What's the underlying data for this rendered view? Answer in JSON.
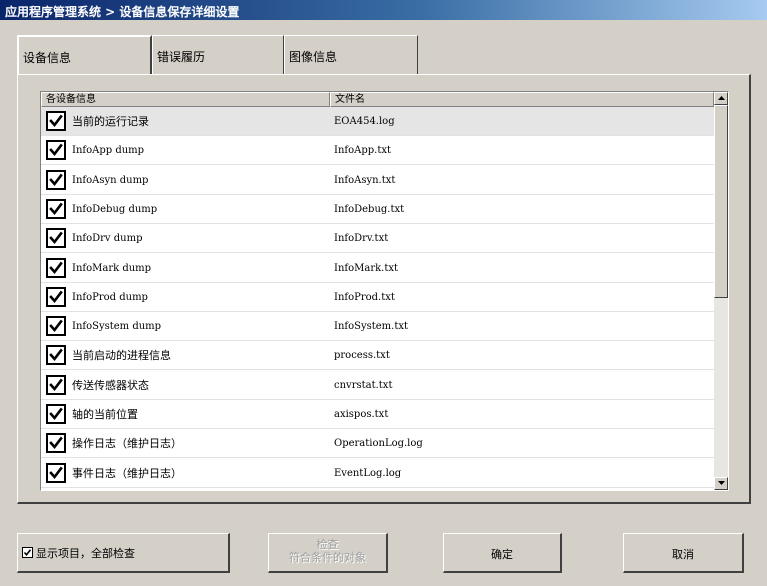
{
  "window": {
    "title": "应用程序管理系统 > 设备信息保存详细设置"
  },
  "tabs": [
    {
      "label": "设备信息",
      "active": true
    },
    {
      "label": "错误履历",
      "active": false
    },
    {
      "label": "图像信息",
      "active": false
    }
  ],
  "list": {
    "headers": [
      "各设备信息",
      "文件名"
    ],
    "rows": [
      {
        "name": "当前的运行记录",
        "file": "EOA454.log",
        "checked": true,
        "selected": true
      },
      {
        "name": "InfoApp dump",
        "file": "InfoApp.txt",
        "checked": true
      },
      {
        "name": "InfoAsyn dump",
        "file": "InfoAsyn.txt",
        "checked": true
      },
      {
        "name": "InfoDebug dump",
        "file": "InfoDebug.txt",
        "checked": true
      },
      {
        "name": "InfoDrv dump",
        "file": "InfoDrv.txt",
        "checked": true
      },
      {
        "name": "InfoMark dump",
        "file": "InfoMark.txt",
        "checked": true
      },
      {
        "name": "InfoProd dump",
        "file": "InfoProd.txt",
        "checked": true
      },
      {
        "name": "InfoSystem dump",
        "file": "InfoSystem.txt",
        "checked": true
      },
      {
        "name": "当前启动的进程信息",
        "file": "process.txt",
        "checked": true
      },
      {
        "name": "传送传感器状态",
        "file": "cnvrstat.txt",
        "checked": true
      },
      {
        "name": "轴的当前位置",
        "file": "axispos.txt",
        "checked": true
      },
      {
        "name": "操作日志（维护日志）",
        "file": "OperationLog.log",
        "checked": true
      },
      {
        "name": "事件日志（维护日志）",
        "file": "EventLog.log",
        "checked": true
      }
    ],
    "scroll_position": 0
  },
  "footer": {
    "show_all_label": "显示项目，全部检查",
    "show_all_checked": true,
    "check_button": {
      "line1": "检查",
      "line2": "符合条件的对象",
      "enabled": false
    },
    "ok_label": "确定",
    "cancel_label": "取消"
  }
}
